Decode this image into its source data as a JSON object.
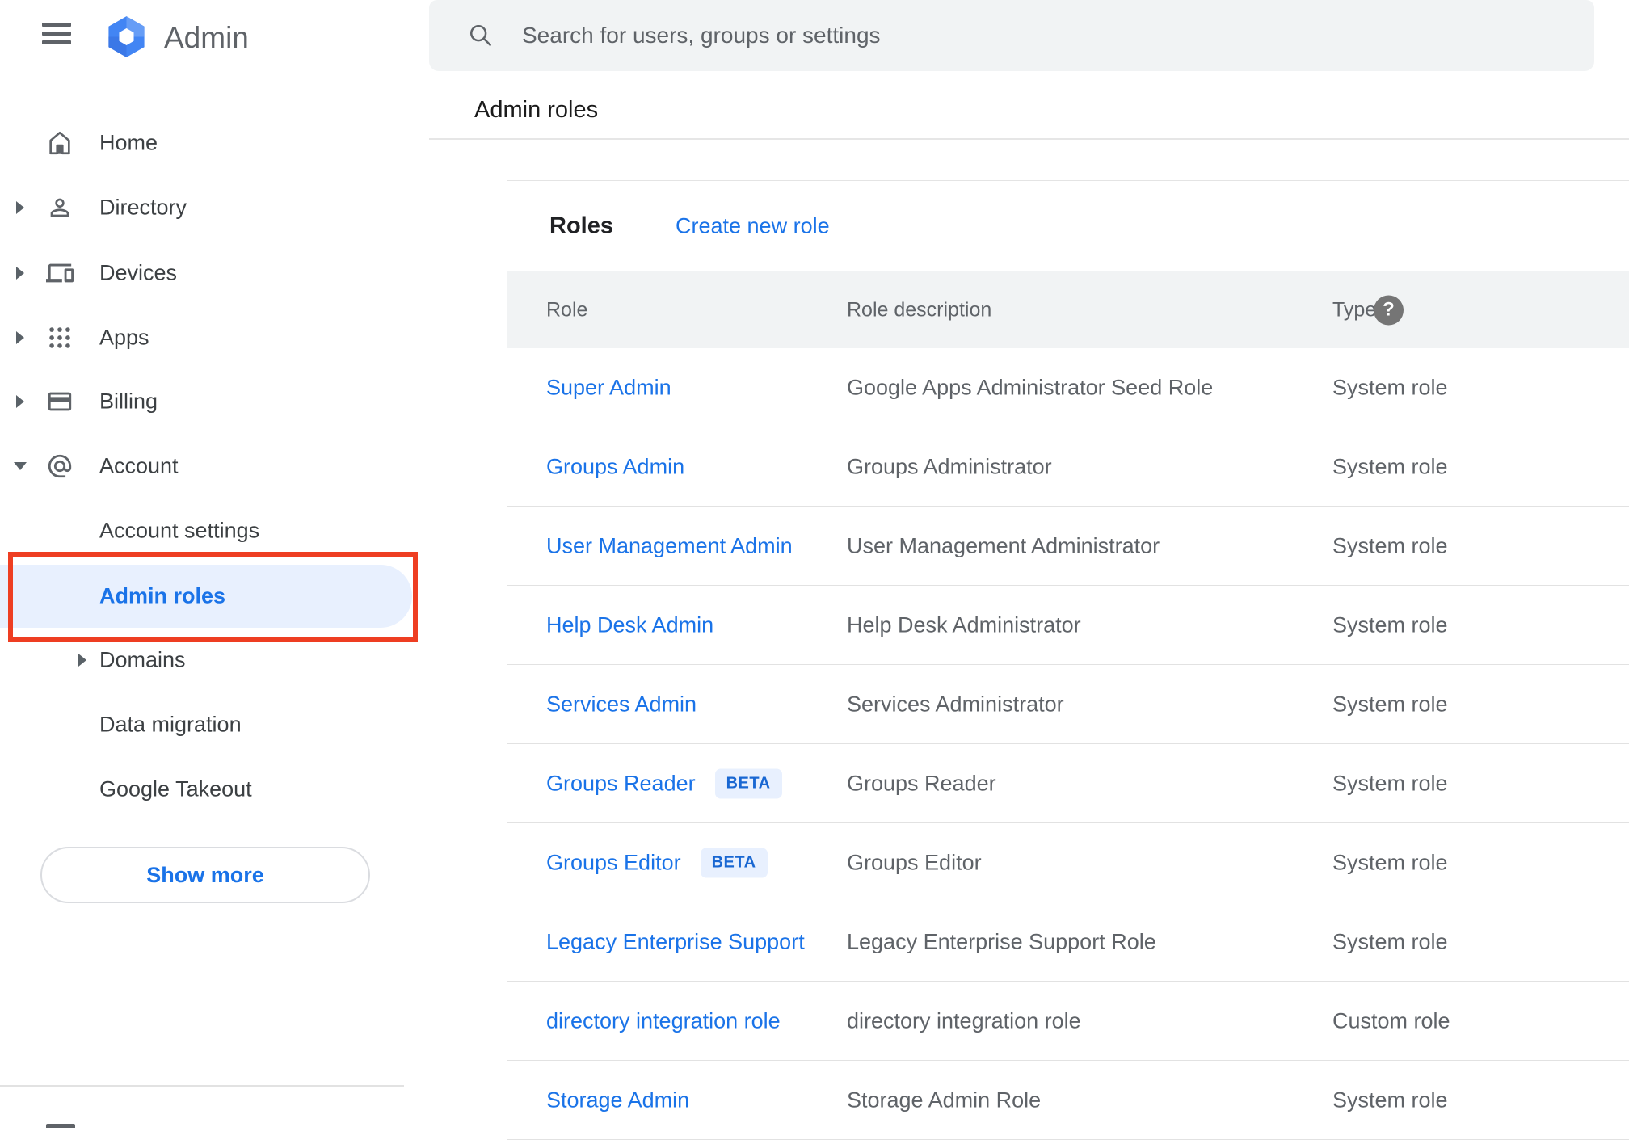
{
  "app": {
    "product_name": "Admin"
  },
  "search": {
    "placeholder": "Search for users, groups or settings"
  },
  "breadcrumb": "Admin roles",
  "sidebar": {
    "items": [
      {
        "label": "Home",
        "icon": "home-icon",
        "expandable": false
      },
      {
        "label": "Directory",
        "icon": "directory-icon",
        "expandable": true
      },
      {
        "label": "Devices",
        "icon": "devices-icon",
        "expandable": true
      },
      {
        "label": "Apps",
        "icon": "apps-icon",
        "expandable": true
      },
      {
        "label": "Billing",
        "icon": "billing-icon",
        "expandable": true
      },
      {
        "label": "Account",
        "icon": "account-icon",
        "expandable": true,
        "expanded": true
      }
    ],
    "account_subitems": [
      {
        "label": "Account settings"
      },
      {
        "label": "Admin roles",
        "selected": true,
        "annotated": true
      },
      {
        "label": "Domains",
        "expandable": true
      },
      {
        "label": "Data migration"
      },
      {
        "label": "Google Takeout"
      }
    ],
    "show_more_label": "Show more"
  },
  "annotation": {
    "shape": "rectangle",
    "color": "#ee3e22",
    "target": "Admin roles sidebar item"
  },
  "content": {
    "card_title": "Roles",
    "create_link": "Create new role",
    "table": {
      "columns": [
        "Role",
        "Role description",
        "Type"
      ],
      "type_help_icon": "question-mark",
      "rows": [
        {
          "role": "Super Admin",
          "beta": "",
          "description": "Google Apps Administrator Seed Role",
          "type": "System role"
        },
        {
          "role": "Groups Admin",
          "beta": "",
          "description": "Groups Administrator",
          "type": "System role"
        },
        {
          "role": "User Management Admin",
          "beta": "",
          "description": "User Management Administrator",
          "type": "System role"
        },
        {
          "role": "Help Desk Admin",
          "beta": "",
          "description": "Help Desk Administrator",
          "type": "System role"
        },
        {
          "role": "Services Admin",
          "beta": "",
          "description": "Services Administrator",
          "type": "System role"
        },
        {
          "role": "Groups Reader",
          "beta": "BETA",
          "description": "Groups Reader",
          "type": "System role"
        },
        {
          "role": "Groups Editor",
          "beta": "BETA",
          "description": "Groups Editor",
          "type": "System role"
        },
        {
          "role": "Legacy Enterprise Support",
          "beta": "",
          "description": "Legacy Enterprise Support Role",
          "type": "System role"
        },
        {
          "role": "directory integration role",
          "beta": "",
          "description": "directory integration role",
          "type": "Custom role"
        },
        {
          "role": "Storage Admin",
          "beta": "",
          "description": "Storage Admin Role",
          "type": "System role"
        }
      ]
    }
  },
  "colors": {
    "accent_blue": "#1a73e8",
    "selected_bg": "#e8f0fe",
    "beta_badge_bg": "#e8f0fe",
    "beta_badge_text": "#1967d2",
    "annotation_red": "#ee3e22",
    "table_header_bg": "#f1f3f4",
    "searchbar_bg": "#f1f3f4",
    "text_gray": "#5f6368",
    "text_dark": "#202124"
  }
}
